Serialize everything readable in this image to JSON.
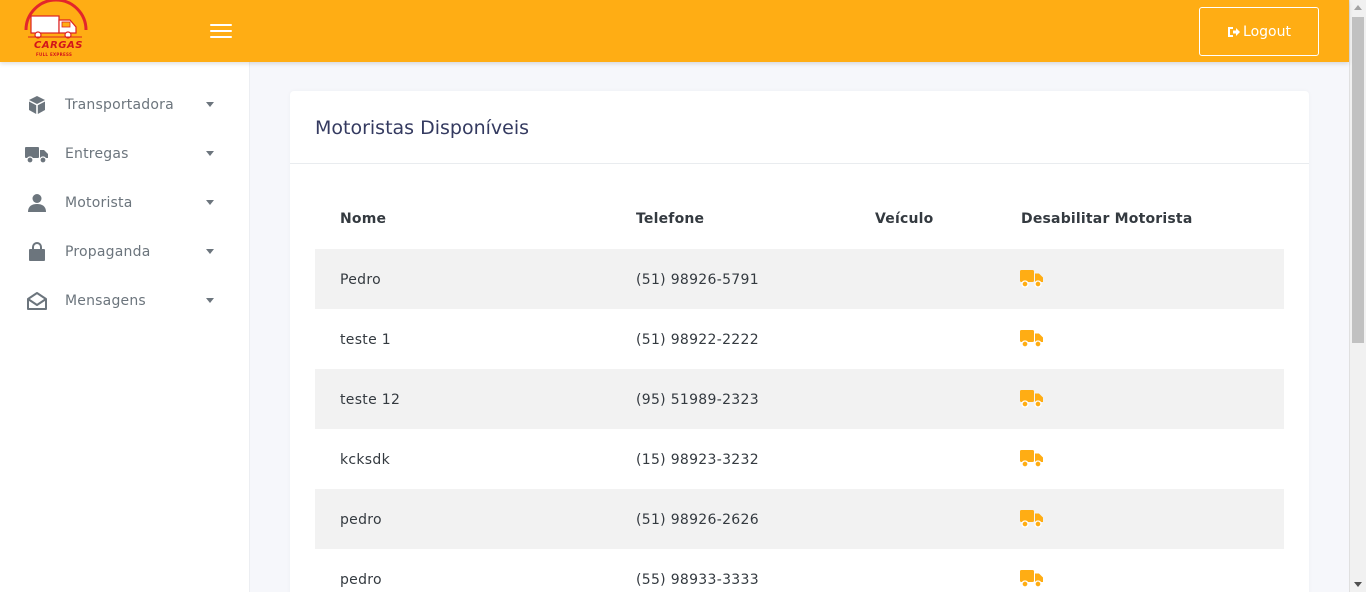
{
  "header": {
    "logo": {
      "brand": "CARGAS",
      "tagline": "FULL EXPRESS"
    },
    "logout_label": "Logout",
    "bg_color": "#ffad14"
  },
  "sidebar": {
    "items": [
      {
        "label": "Transportadora",
        "icon": "box-icon"
      },
      {
        "label": "Entregas",
        "icon": "truck-icon"
      },
      {
        "label": "Motorista",
        "icon": "user-icon"
      },
      {
        "label": "Propaganda",
        "icon": "shopping-bag-icon"
      },
      {
        "label": "Mensagens",
        "icon": "envelope-open-icon"
      }
    ]
  },
  "main": {
    "card_title": "Motoristas Disponíveis",
    "table": {
      "columns": [
        "Nome",
        "Telefone",
        "Veículo",
        "Desabilitar Motorista"
      ],
      "rows": [
        {
          "nome": "Pedro",
          "telefone": "(51) 98926-5791",
          "veiculo": ""
        },
        {
          "nome": "teste 1",
          "telefone": "(51) 98922-2222",
          "veiculo": ""
        },
        {
          "nome": "teste 12",
          "telefone": "(95) 51989-2323",
          "veiculo": ""
        },
        {
          "nome": "kcksdk",
          "telefone": "(15) 98923-3232",
          "veiculo": ""
        },
        {
          "nome": "pedro",
          "telefone": "(51) 98926-2626",
          "veiculo": ""
        },
        {
          "nome": "pedro",
          "telefone": "(55) 98933-3333",
          "veiculo": ""
        }
      ],
      "action_icon": "truck-icon",
      "action_color": "#ffad14"
    }
  }
}
